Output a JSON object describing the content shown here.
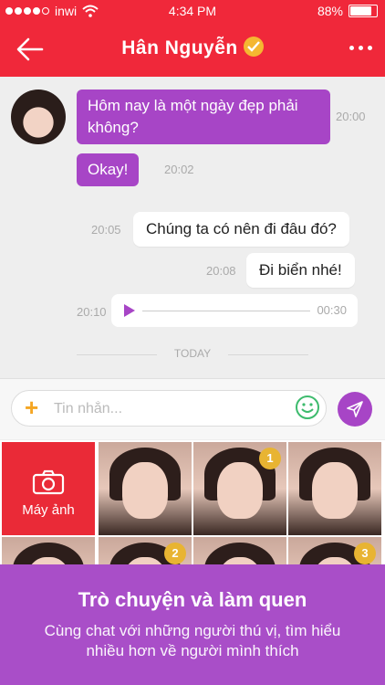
{
  "status_bar": {
    "carrier": "inwi",
    "time": "4:34 PM",
    "battery": "88%",
    "battery_level": 0.88
  },
  "nav": {
    "title": "Hân Nguyễn"
  },
  "messages": {
    "in1": {
      "text": "Hôm nay là một ngày đẹp phải không?",
      "time": "20:00"
    },
    "in2": {
      "text": "Okay!",
      "time": "20:02"
    },
    "out1": {
      "text": "Chúng ta có nên đi đâu đó?",
      "time": "20:05"
    },
    "out2": {
      "text": "Đi biển nhé!",
      "time": "20:08"
    },
    "audio": {
      "duration": "00:30",
      "time": "20:10"
    }
  },
  "divider": {
    "label": "TODAY"
  },
  "composer": {
    "placeholder": "Tin nhắn..."
  },
  "gallery": {
    "camera_label": "Máy ảnh",
    "badges": [
      "1",
      "2",
      "3"
    ]
  },
  "promo": {
    "title": "Trò chuyện và làm quen",
    "subtitle": "Cùng chat với những người thú vị, tìm hiểu nhiều hơn về người mình thích"
  },
  "colors": {
    "brand": "#f0283a",
    "accent": "#a745c6",
    "badge": "#e8b432"
  }
}
